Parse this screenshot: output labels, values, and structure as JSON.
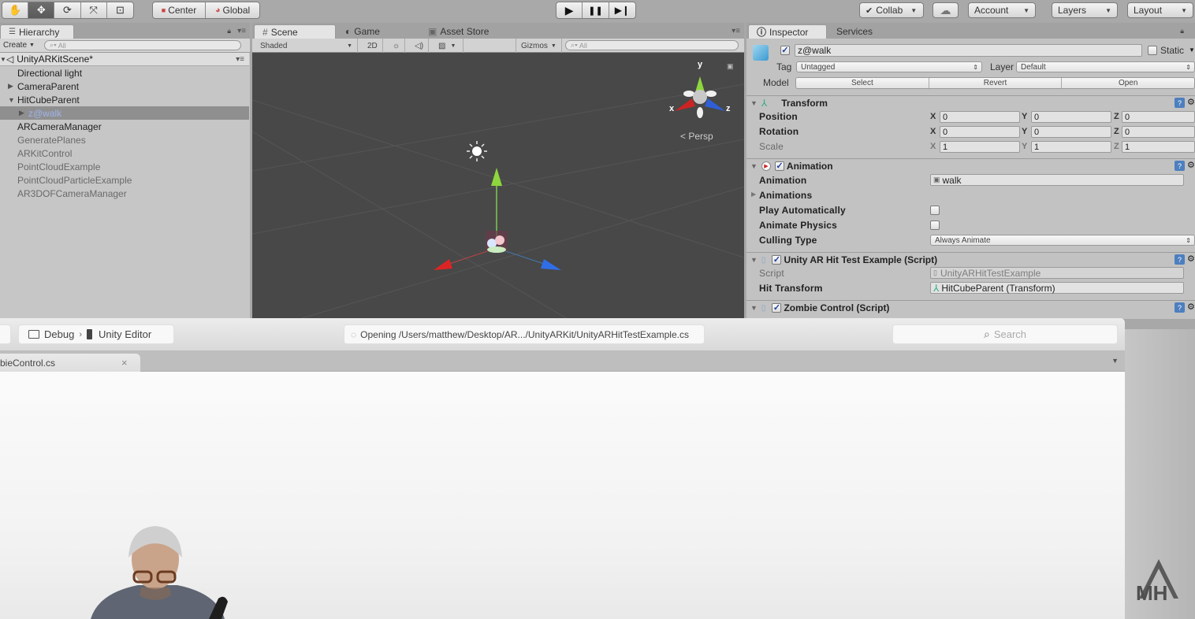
{
  "toolbar": {
    "transform_tools": [
      {
        "name": "hand-tool",
        "icon": "hand-icon",
        "glyph": "✋",
        "active": false
      },
      {
        "name": "move-tool",
        "icon": "move-icon",
        "glyph": "✥",
        "active": true
      },
      {
        "name": "rotate-tool",
        "icon": "rotate-icon",
        "glyph": "⟳",
        "active": false
      },
      {
        "name": "scale-tool",
        "icon": "scale-icon",
        "glyph": "⤧",
        "active": false
      },
      {
        "name": "rect-tool",
        "icon": "rect-icon",
        "glyph": "⊡",
        "active": false
      }
    ],
    "pivot_mode": "Center",
    "pivot_rotation": "Global",
    "play_glyph": "▶",
    "pause_glyph": "❚❚",
    "step_glyph": "▶❙",
    "collab": "Collab",
    "cloud_glyph": "☁",
    "account": "Account",
    "layers": "Layers",
    "layout": "Layout"
  },
  "hierarchy": {
    "tab": "Hierarchy",
    "create": "Create",
    "search_placeholder": "All",
    "scene_name": "UnityARKitScene*",
    "items": [
      {
        "label": "Directional light",
        "indent": 0,
        "arrow": "",
        "dim": false,
        "selected": false
      },
      {
        "label": "CameraParent",
        "indent": 0,
        "arrow": "▶",
        "dim": false,
        "selected": false
      },
      {
        "label": "HitCubeParent",
        "indent": 0,
        "arrow": "▼",
        "dim": false,
        "selected": false
      },
      {
        "label": "z@walk",
        "indent": 1,
        "arrow": "▶",
        "dim": false,
        "selected": true
      },
      {
        "label": "ARCameraManager",
        "indent": 0,
        "arrow": "",
        "dim": false,
        "selected": false
      },
      {
        "label": "GeneratePlanes",
        "indent": 0,
        "arrow": "",
        "dim": true,
        "selected": false
      },
      {
        "label": "ARKitControl",
        "indent": 0,
        "arrow": "",
        "dim": true,
        "selected": false
      },
      {
        "label": "PointCloudExample",
        "indent": 0,
        "arrow": "",
        "dim": true,
        "selected": false
      },
      {
        "label": "PointCloudParticleExample",
        "indent": 0,
        "arrow": "",
        "dim": true,
        "selected": false
      },
      {
        "label": "AR3DOFCameraManager",
        "indent": 0,
        "arrow": "",
        "dim": true,
        "selected": false
      }
    ]
  },
  "scene": {
    "tabs": [
      "Scene",
      "Game",
      "Asset Store"
    ],
    "shading": "Shaded",
    "mode_2d": "2D",
    "gizmos": "Gizmos",
    "search_placeholder": "All",
    "gizmo_labels": {
      "x": "x",
      "y": "y",
      "z": "z"
    },
    "projection": "Persp"
  },
  "inspector": {
    "tabs": [
      "Inspector",
      "Services"
    ],
    "object_name": "z@walk",
    "active": true,
    "static_label": "Static",
    "static": false,
    "tag_label": "Tag",
    "tag": "Untagged",
    "layer_label": "Layer",
    "layer": "Default",
    "model_label": "Model",
    "model_buttons": [
      "Select",
      "Revert",
      "Open"
    ],
    "transform": {
      "title": "Transform",
      "rows": [
        {
          "label": "Position",
          "x": "0",
          "y": "0",
          "z": "0",
          "dim": false
        },
        {
          "label": "Rotation",
          "x": "0",
          "y": "0",
          "z": "0",
          "dim": false
        },
        {
          "label": "Scale",
          "x": "1",
          "y": "1",
          "z": "1",
          "dim": true
        }
      ]
    },
    "animation": {
      "title": "Animation",
      "enabled": true,
      "animation_label": "Animation",
      "animation_value": "walk",
      "animations_label": "Animations",
      "play_auto_label": "Play Automatically",
      "play_auto": false,
      "animate_physics_label": "Animate Physics",
      "animate_physics": false,
      "culling_label": "Culling Type",
      "culling_value": "Always Animate"
    },
    "hit_test": {
      "title": "Unity AR Hit Test Example (Script)",
      "enabled": true,
      "script_label": "Script",
      "script_value": "UnityARHitTestExample",
      "hit_transform_label": "Hit Transform",
      "hit_transform_value": "HitCubeParent (Transform)"
    },
    "zombie": {
      "title": "Zombie Control (Script)",
      "enabled": true
    }
  },
  "xcode": {
    "scheme": "Debug",
    "destination": "Unity Editor",
    "status": "Opening /Users/matthew/Desktop/AR.../UnityARKit/UnityARHitTestExample.cs",
    "search_placeholder": "Search",
    "open_tab": "bieControl.cs",
    "close_glyph": "×"
  },
  "watermark": "MH"
}
